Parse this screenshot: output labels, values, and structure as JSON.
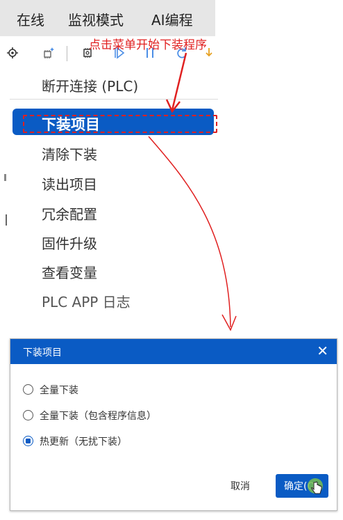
{
  "menubar": {
    "items": [
      {
        "label": "在线"
      },
      {
        "label": "监视模式"
      },
      {
        "label": "AI编程"
      }
    ]
  },
  "annotation": {
    "text": "点击菜单开始下装程序",
    "color": "#e02020"
  },
  "toolbar": {
    "icons": [
      "chip-settings-icon",
      "chip-sparkle-icon",
      "chip-settings-icon",
      "run-icon",
      "pause-icon",
      "refresh-icon",
      "step-icon"
    ]
  },
  "menu": {
    "items": [
      {
        "label": "断开连接 (PLC)"
      },
      {
        "label": "下装项目",
        "selected": true
      },
      {
        "label": "清除下装"
      },
      {
        "label": "读出项目"
      },
      {
        "label": "冗余配置"
      },
      {
        "label": "固件升级"
      },
      {
        "label": "查看变量"
      },
      {
        "label": "PLC APP 日志"
      }
    ]
  },
  "dialog": {
    "title": "下装项目",
    "options": [
      {
        "label": "全量下装",
        "checked": false
      },
      {
        "label": "全量下装（包含程序信息）",
        "checked": false
      },
      {
        "label": "热更新（无扰下装）",
        "checked": true
      }
    ],
    "cancel_label": "取消",
    "ok_label": "确定(O)"
  },
  "colors": {
    "accent": "#0a5bc4",
    "annotation": "#e02020",
    "menubar_bg": "#e6e6e6"
  }
}
